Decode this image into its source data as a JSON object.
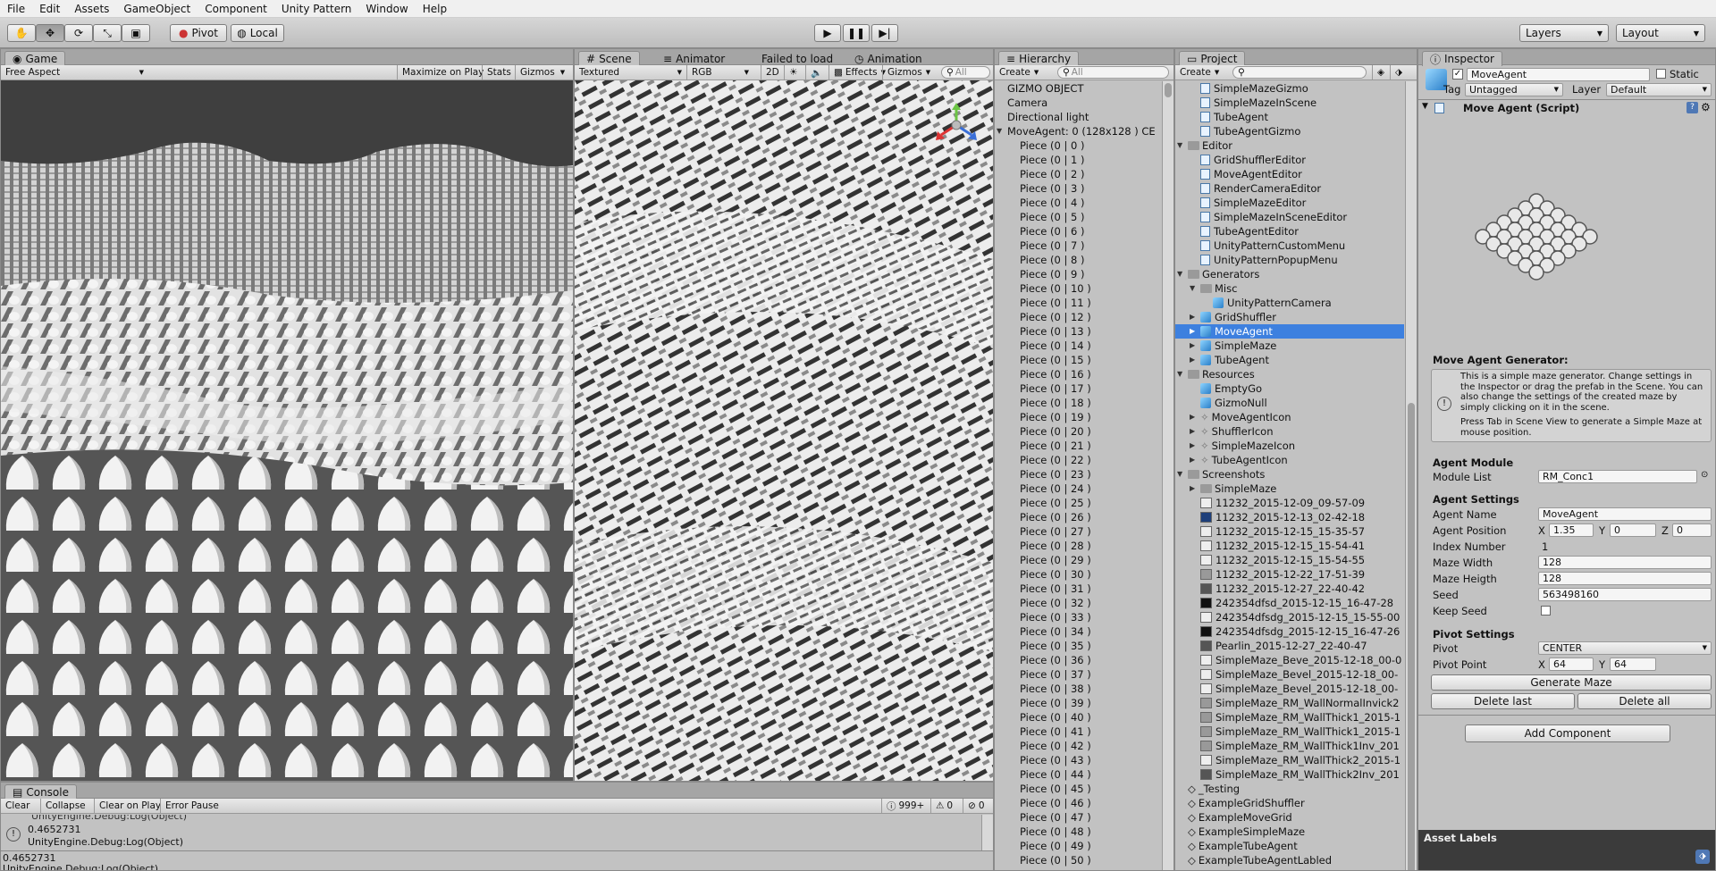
{
  "menu": [
    "File",
    "Edit",
    "Assets",
    "GameObject",
    "Component",
    "Unity Pattern",
    "Window",
    "Help"
  ],
  "toolbar": {
    "pivot": "Pivot",
    "local": "Local",
    "layers": "Layers",
    "layout": "Layout"
  },
  "game": {
    "tab": "Game",
    "aspect": "Free Aspect",
    "maximize": "Maximize on Play",
    "stats": "Stats",
    "gizmos": "Gizmos"
  },
  "scene": {
    "tab": "Scene",
    "animator_tab": "Animator",
    "failed": "Failed to load",
    "animation_tab": "Animation",
    "shading": "Textured",
    "channel": "RGB",
    "mode2d": "2D",
    "effects": "Effects",
    "gizmos": "Gizmos",
    "search": "All"
  },
  "hierarchy": {
    "tab": "Hierarchy",
    "create": "Create",
    "search_placeholder": "All",
    "items": [
      {
        "label": "GIZMO OBJECT",
        "indent": 0,
        "expand": ""
      },
      {
        "label": "Camera",
        "indent": 0,
        "expand": ""
      },
      {
        "label": "Directional light",
        "indent": 0,
        "expand": ""
      },
      {
        "label": "MoveAgent: 0 (128x128 ) CE",
        "indent": 0,
        "expand": "▼"
      },
      {
        "label": "Piece (0 | 0 )",
        "indent": 1,
        "expand": ""
      },
      {
        "label": "Piece (0 | 1 )",
        "indent": 1,
        "expand": ""
      },
      {
        "label": "Piece (0 | 2 )",
        "indent": 1,
        "expand": ""
      },
      {
        "label": "Piece (0 | 3 )",
        "indent": 1,
        "expand": ""
      },
      {
        "label": "Piece (0 | 4 )",
        "indent": 1,
        "expand": ""
      },
      {
        "label": "Piece (0 | 5 )",
        "indent": 1,
        "expand": ""
      },
      {
        "label": "Piece (0 | 6 )",
        "indent": 1,
        "expand": ""
      },
      {
        "label": "Piece (0 | 7 )",
        "indent": 1,
        "expand": ""
      },
      {
        "label": "Piece (0 | 8 )",
        "indent": 1,
        "expand": ""
      },
      {
        "label": "Piece (0 | 9 )",
        "indent": 1,
        "expand": ""
      },
      {
        "label": "Piece (0 | 10 )",
        "indent": 1,
        "expand": ""
      },
      {
        "label": "Piece (0 | 11 )",
        "indent": 1,
        "expand": ""
      },
      {
        "label": "Piece (0 | 12 )",
        "indent": 1,
        "expand": ""
      },
      {
        "label": "Piece (0 | 13 )",
        "indent": 1,
        "expand": ""
      },
      {
        "label": "Piece (0 | 14 )",
        "indent": 1,
        "expand": ""
      },
      {
        "label": "Piece (0 | 15 )",
        "indent": 1,
        "expand": ""
      },
      {
        "label": "Piece (0 | 16 )",
        "indent": 1,
        "expand": ""
      },
      {
        "label": "Piece (0 | 17 )",
        "indent": 1,
        "expand": ""
      },
      {
        "label": "Piece (0 | 18 )",
        "indent": 1,
        "expand": ""
      },
      {
        "label": "Piece (0 | 19 )",
        "indent": 1,
        "expand": ""
      },
      {
        "label": "Piece (0 | 20 )",
        "indent": 1,
        "expand": ""
      },
      {
        "label": "Piece (0 | 21 )",
        "indent": 1,
        "expand": ""
      },
      {
        "label": "Piece (0 | 22 )",
        "indent": 1,
        "expand": ""
      },
      {
        "label": "Piece (0 | 23 )",
        "indent": 1,
        "expand": ""
      },
      {
        "label": "Piece (0 | 24 )",
        "indent": 1,
        "expand": ""
      },
      {
        "label": "Piece (0 | 25 )",
        "indent": 1,
        "expand": ""
      },
      {
        "label": "Piece (0 | 26 )",
        "indent": 1,
        "expand": ""
      },
      {
        "label": "Piece (0 | 27 )",
        "indent": 1,
        "expand": ""
      },
      {
        "label": "Piece (0 | 28 )",
        "indent": 1,
        "expand": ""
      },
      {
        "label": "Piece (0 | 29 )",
        "indent": 1,
        "expand": ""
      },
      {
        "label": "Piece (0 | 30 )",
        "indent": 1,
        "expand": ""
      },
      {
        "label": "Piece (0 | 31 )",
        "indent": 1,
        "expand": ""
      },
      {
        "label": "Piece (0 | 32 )",
        "indent": 1,
        "expand": ""
      },
      {
        "label": "Piece (0 | 33 )",
        "indent": 1,
        "expand": ""
      },
      {
        "label": "Piece (0 | 34 )",
        "indent": 1,
        "expand": ""
      },
      {
        "label": "Piece (0 | 35 )",
        "indent": 1,
        "expand": ""
      },
      {
        "label": "Piece (0 | 36 )",
        "indent": 1,
        "expand": ""
      },
      {
        "label": "Piece (0 | 37 )",
        "indent": 1,
        "expand": ""
      },
      {
        "label": "Piece (0 | 38 )",
        "indent": 1,
        "expand": ""
      },
      {
        "label": "Piece (0 | 39 )",
        "indent": 1,
        "expand": ""
      },
      {
        "label": "Piece (0 | 40 )",
        "indent": 1,
        "expand": ""
      },
      {
        "label": "Piece (0 | 41 )",
        "indent": 1,
        "expand": ""
      },
      {
        "label": "Piece (0 | 42 )",
        "indent": 1,
        "expand": ""
      },
      {
        "label": "Piece (0 | 43 )",
        "indent": 1,
        "expand": ""
      },
      {
        "label": "Piece (0 | 44 )",
        "indent": 1,
        "expand": ""
      },
      {
        "label": "Piece (0 | 45 )",
        "indent": 1,
        "expand": ""
      },
      {
        "label": "Piece (0 | 46 )",
        "indent": 1,
        "expand": ""
      },
      {
        "label": "Piece (0 | 47 )",
        "indent": 1,
        "expand": ""
      },
      {
        "label": "Piece (0 | 48 )",
        "indent": 1,
        "expand": ""
      },
      {
        "label": "Piece (0 | 49 )",
        "indent": 1,
        "expand": ""
      },
      {
        "label": "Piece (0 | 50 )",
        "indent": 1,
        "expand": ""
      }
    ]
  },
  "project": {
    "tab": "Project",
    "create": "Create",
    "items": [
      {
        "label": "SimpleMazeGizmo",
        "indent": 1,
        "kind": "script",
        "expand": ""
      },
      {
        "label": "SimpleMazeInScene",
        "indent": 1,
        "kind": "script",
        "expand": ""
      },
      {
        "label": "TubeAgent",
        "indent": 1,
        "kind": "script",
        "expand": ""
      },
      {
        "label": "TubeAgentGizmo",
        "indent": 1,
        "kind": "script",
        "expand": ""
      },
      {
        "label": "Editor",
        "indent": 0,
        "kind": "folder",
        "expand": "▼"
      },
      {
        "label": "GridShufflerEditor",
        "indent": 1,
        "kind": "script",
        "expand": ""
      },
      {
        "label": "MoveAgentEditor",
        "indent": 1,
        "kind": "script",
        "expand": ""
      },
      {
        "label": "RenderCameraEditor",
        "indent": 1,
        "kind": "script",
        "expand": ""
      },
      {
        "label": "SimpleMazeEditor",
        "indent": 1,
        "kind": "script",
        "expand": ""
      },
      {
        "label": "SimpleMazeInSceneEditor",
        "indent": 1,
        "kind": "script",
        "expand": ""
      },
      {
        "label": "TubeAgentEditor",
        "indent": 1,
        "kind": "script",
        "expand": ""
      },
      {
        "label": "UnityPatternCustomMenu",
        "indent": 1,
        "kind": "script",
        "expand": ""
      },
      {
        "label": "UnityPatternPopupMenu",
        "indent": 1,
        "kind": "script",
        "expand": ""
      },
      {
        "label": "Generators",
        "indent": 0,
        "kind": "folder",
        "expand": "▼"
      },
      {
        "label": "Misc",
        "indent": 1,
        "kind": "folder",
        "expand": "▼"
      },
      {
        "label": "UnityPatternCamera",
        "indent": 2,
        "kind": "prefab",
        "expand": ""
      },
      {
        "label": "GridShuffler",
        "indent": 1,
        "kind": "prefab",
        "expand": "▶"
      },
      {
        "label": "MoveAgent",
        "indent": 1,
        "kind": "prefab",
        "expand": "▶",
        "selected": true
      },
      {
        "label": "SimpleMaze",
        "indent": 1,
        "kind": "prefab",
        "expand": "▶"
      },
      {
        "label": "TubeAgent",
        "indent": 1,
        "kind": "prefab",
        "expand": "▶"
      },
      {
        "label": "Resources",
        "indent": 0,
        "kind": "folder",
        "expand": "▼"
      },
      {
        "label": "EmptyGo",
        "indent": 1,
        "kind": "prefab",
        "expand": ""
      },
      {
        "label": "GizmoNull",
        "indent": 1,
        "kind": "prefab",
        "expand": ""
      },
      {
        "label": "MoveAgentIcon",
        "indent": 1,
        "kind": "icon",
        "expand": "▶"
      },
      {
        "label": "ShufflerIcon",
        "indent": 1,
        "kind": "icon",
        "expand": "▶"
      },
      {
        "label": "SimpleMazeIcon",
        "indent": 1,
        "kind": "icon",
        "expand": "▶"
      },
      {
        "label": "TubeAgentIcon",
        "indent": 1,
        "kind": "icon",
        "expand": "▶"
      },
      {
        "label": "Screenshots",
        "indent": 0,
        "kind": "folder",
        "expand": "▼"
      },
      {
        "label": "SimpleMaze",
        "indent": 1,
        "kind": "folder",
        "expand": "▶"
      },
      {
        "label": "11232_2015-12-09_09-57-09",
        "indent": 1,
        "kind": "img-light",
        "expand": ""
      },
      {
        "label": "11232_2015-12-13_02-42-18",
        "indent": 1,
        "kind": "img-blue",
        "expand": ""
      },
      {
        "label": "11232_2015-12-15_15-35-57",
        "indent": 1,
        "kind": "img-light",
        "expand": ""
      },
      {
        "label": "11232_2015-12-15_15-54-41",
        "indent": 1,
        "kind": "img-light",
        "expand": ""
      },
      {
        "label": "11232_2015-12-15_15-54-55",
        "indent": 1,
        "kind": "img-light",
        "expand": ""
      },
      {
        "label": "11232_2015-12-22_17-51-39",
        "indent": 1,
        "kind": "img-mid",
        "expand": ""
      },
      {
        "label": "11232_2015-12-27_22-40-42",
        "indent": 1,
        "kind": "img-dark",
        "expand": ""
      },
      {
        "label": "242354dfsd_2015-12-15_16-47-28",
        "indent": 1,
        "kind": "img-black",
        "expand": ""
      },
      {
        "label": "242354dfsdg_2015-12-15_15-55-00",
        "indent": 1,
        "kind": "img-light",
        "expand": ""
      },
      {
        "label": "242354dfsdg_2015-12-15_16-47-26",
        "indent": 1,
        "kind": "img-black",
        "expand": ""
      },
      {
        "label": "Pearlin_2015-12-27_22-40-47",
        "indent": 1,
        "kind": "img-dark",
        "expand": ""
      },
      {
        "label": "SimpleMaze_Beve_2015-12-18_00-0",
        "indent": 1,
        "kind": "img-light",
        "expand": ""
      },
      {
        "label": "SimpleMaze_Bevel_2015-12-18_00-",
        "indent": 1,
        "kind": "img-light",
        "expand": ""
      },
      {
        "label": "SimpleMaze_Bevel_2015-12-18_00-",
        "indent": 1,
        "kind": "img-light",
        "expand": ""
      },
      {
        "label": "SimpleMaze_RM_WallNormalInvick2",
        "indent": 1,
        "kind": "img-mid",
        "expand": ""
      },
      {
        "label": "SimpleMaze_RM_WallThick1_2015-1",
        "indent": 1,
        "kind": "img-mid",
        "expand": ""
      },
      {
        "label": "SimpleMaze_RM_WallThick1_2015-1",
        "indent": 1,
        "kind": "img-mid",
        "expand": ""
      },
      {
        "label": "SimpleMaze_RM_WallThick1Inv_201",
        "indent": 1,
        "kind": "img-mid",
        "expand": ""
      },
      {
        "label": "SimpleMaze_RM_WallThick2_2015-1",
        "indent": 1,
        "kind": "img-light",
        "expand": ""
      },
      {
        "label": "SimpleMaze_RM_WallThick2Inv_201",
        "indent": 1,
        "kind": "img-dark",
        "expand": ""
      },
      {
        "label": "_Testing",
        "indent": 0,
        "kind": "unity",
        "expand": ""
      },
      {
        "label": "ExampleGridShuffler",
        "indent": 0,
        "kind": "unity",
        "expand": ""
      },
      {
        "label": "ExampleMoveGrid",
        "indent": 0,
        "kind": "unity",
        "expand": ""
      },
      {
        "label": "ExampleSimpleMaze",
        "indent": 0,
        "kind": "unity",
        "expand": ""
      },
      {
        "label": "ExampleTubeAgent",
        "indent": 0,
        "kind": "unity",
        "expand": ""
      },
      {
        "label": "ExampleTubeAgentLabled",
        "indent": 0,
        "kind": "unity",
        "expand": ""
      }
    ]
  },
  "inspector": {
    "tab": "Inspector",
    "object_name": "MoveAgent",
    "static": "Static",
    "tag_label": "Tag",
    "tag_value": "Untagged",
    "layer_label": "Layer",
    "layer_value": "Default",
    "component": "Move Agent (Script)",
    "generator_title": "Move Agent Generator:",
    "help_text_1": "This is a simple maze generator. Change settings in the Inspector or drag the prefab in the Scene. You can also change the settings of the created maze by simply clicking on it in the scene.",
    "help_text_2": "Press Tab in Scene View to generate a Simple Maze at mouse position.",
    "agent_module_header": "Agent Module",
    "module_list_label": "Module List",
    "module_list_value": "RM_Conc1",
    "agent_settings_header": "Agent Settings",
    "agent_name_label": "Agent Name",
    "agent_name_value": "MoveAgent",
    "agent_position_label": "Agent Position",
    "pos_x_label": "X",
    "pos_x": "1.35",
    "pos_y_label": "Y",
    "pos_y": "0",
    "pos_z_label": "Z",
    "pos_z": "0",
    "index_label": "Index Number",
    "index_value": "1",
    "maze_width_label": "Maze Width",
    "maze_width_value": "128",
    "maze_height_label": "Maze Heigth",
    "maze_height_value": "128",
    "seed_label": "Seed",
    "seed_value": "563498160",
    "keep_seed_label": "Keep Seed",
    "pivot_settings_header": "Pivot Settings",
    "pivot_label": "Pivot",
    "pivot_value": "CENTER",
    "pivot_point_label": "Pivot Point",
    "pp_x_label": "X",
    "pp_x": "64",
    "pp_y_label": "Y",
    "pp_y": "64",
    "generate_button": "Generate Maze",
    "delete_last_button": "Delete last",
    "delete_all_button": "Delete all",
    "add_component_button": "Add Component",
    "asset_labels": "Asset Labels"
  },
  "console": {
    "tab": "Console",
    "clear": "Clear",
    "collapse": "Collapse",
    "clear_on_play": "Clear on Play",
    "error_pause": "Error Pause",
    "log_count": "999+",
    "warn_count": "0",
    "err_count": "0",
    "partial_line": "UnityEngine.Debug:Log(Object)",
    "entry_value": "0.4652731",
    "entry_trace": "UnityEngine.Debug:Log(Object)",
    "status_value": "0.4652731",
    "status_trace": "UnityEngine.Debug:Log(Object)"
  },
  "colors": {
    "selection": "#3d80df",
    "panel_bg": "#c2c2c2",
    "viewport_sky": "#4a4a4a"
  }
}
